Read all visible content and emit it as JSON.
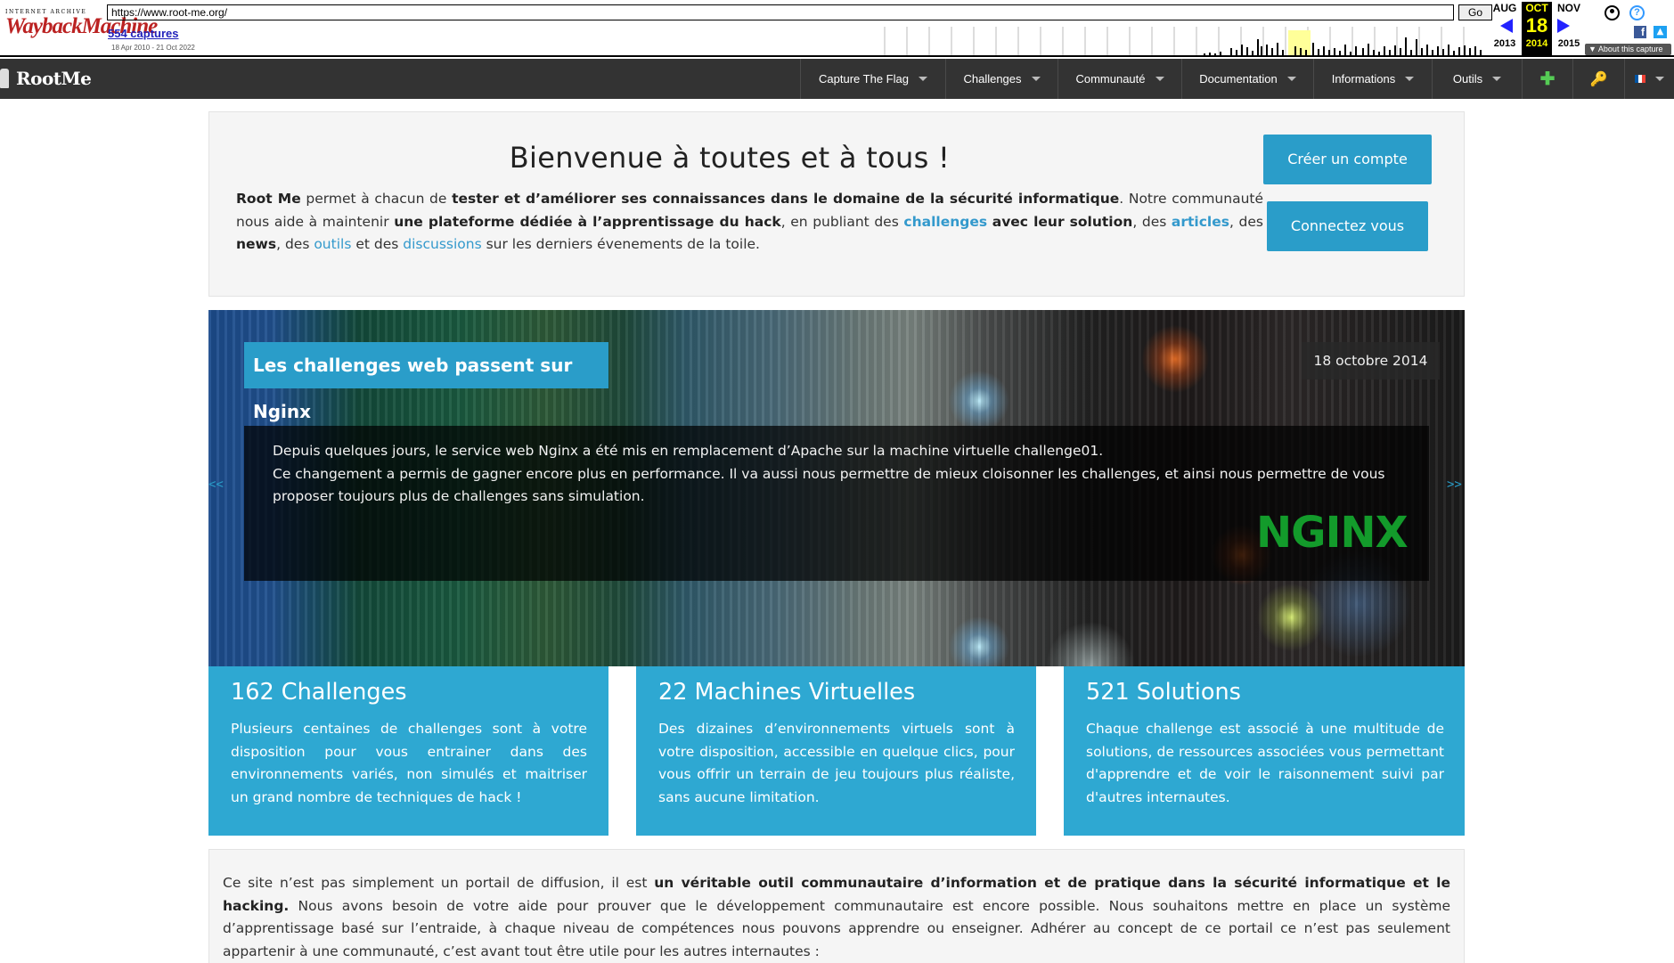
{
  "wayback": {
    "logo_top": "INTERNET ARCHIVE",
    "logo_main": "WaybackMachine",
    "url": "https://www.root-me.org/",
    "go_label": "Go",
    "captures": "554 captures",
    "range": "18 Apr 2010 - 21 Oct 2022",
    "months": [
      {
        "month": "AUG",
        "day": "",
        "year": "2013"
      },
      {
        "month": "OCT",
        "day": "18",
        "year": "2014"
      },
      {
        "month": "NOV",
        "day": "",
        "year": "2015"
      }
    ],
    "about": "About this capture",
    "icons": [
      "user-icon",
      "help-icon",
      "facebook-icon",
      "twitter-icon"
    ]
  },
  "nav": {
    "brand": "RootMe",
    "items": [
      {
        "label": "Capture The Flag"
      },
      {
        "label": "Challenges"
      },
      {
        "label": "Communauté"
      },
      {
        "label": "Documentation"
      },
      {
        "label": "Informations"
      },
      {
        "label": "Outils"
      }
    ],
    "icons": [
      "plus-icon",
      "key-icon",
      "flag-fr-icon"
    ]
  },
  "welcome": {
    "title": "Bienvenue à toutes et à tous !",
    "p1_brand": "Root Me",
    "p1_a": " permet à chacun de ",
    "p1_b": "tester et d’améliorer ses connaissances dans le domaine de la sécurité informatique",
    "p1_c": ". Notre communauté nous aide à maintenir ",
    "p1_d": "une plateforme dédiée à l’apprentissage du hack",
    "p1_e": ", en publiant des ",
    "link_challenges": "challenges",
    "p1_f": "avec leur solution",
    "p1_g": ", des ",
    "link_articles": "articles",
    "p1_h": ", des ",
    "p1_news": "news",
    "p1_i": ", des ",
    "link_outils": "outils",
    "p1_j": " et des ",
    "link_discussions": "discussions",
    "p1_k": " sur les derniers évenements de la toile.",
    "create_account": "Créer un compte",
    "login": "Connectez vous"
  },
  "banner": {
    "title": "Les challenges web passent sur Nginx",
    "date": "18 octobre 2014",
    "line1": "Depuis quelques jours, le service web Nginx a été mis en remplacement d’Apache sur la machine virtuelle challenge01.",
    "line2": "Ce changement a permis de gagner encore plus en performance. Il va aussi nous permettre de mieux cloisonner les challenges, et ainsi nous permettre de vous proposer toujours plus de challenges sans simulation.",
    "logo": "NGINX",
    "prev": "<<",
    "next": ">>"
  },
  "stats": [
    {
      "title": "162 Challenges",
      "text": "Plusieurs centaines de challenges sont à votre disposition pour vous entrainer dans des environnements variés, non simulés et maitriser un grand nombre de techniques de hack !"
    },
    {
      "title": "22 Machines Virtuelles",
      "text": "Des dizaines d’environnements virtuels sont à votre disposition, accessible en quelque clics, pour vous offrir un terrain de jeu toujours plus réaliste, sans aucune limitation."
    },
    {
      "title": "521 Solutions",
      "text": "Chaque challenge est associé à une multitude de solutions, de ressources associées vous permettant d'apprendre et de voir le raisonnement suivi par d'autres internautes."
    }
  ],
  "about": {
    "a": "Ce site n’est pas simplement un portail de diffusion, il est ",
    "b": "un véritable outil communautaire d’information et de pratique dans la sécurité informatique et le hacking.",
    "c": " Nous avons besoin de votre aide pour prouver que le développement communautaire est encore possible. Nous souhaitons mettre en place un système d’apprentissage basé sur l’entraide, à chaque niveau de compétences nous pouvons apprendre ou enseigner. Adhérer au concept de ce portail ce n’est pas seulement appartenir à une communauté, c’est avant tout être utile pour les autres internautes :"
  },
  "colors": {
    "accent": "#2a9dc9",
    "stat_bg": "#2ea8d2",
    "nav_bg": "#333333",
    "link": "#3399cc",
    "nginx": "#139b2b"
  }
}
